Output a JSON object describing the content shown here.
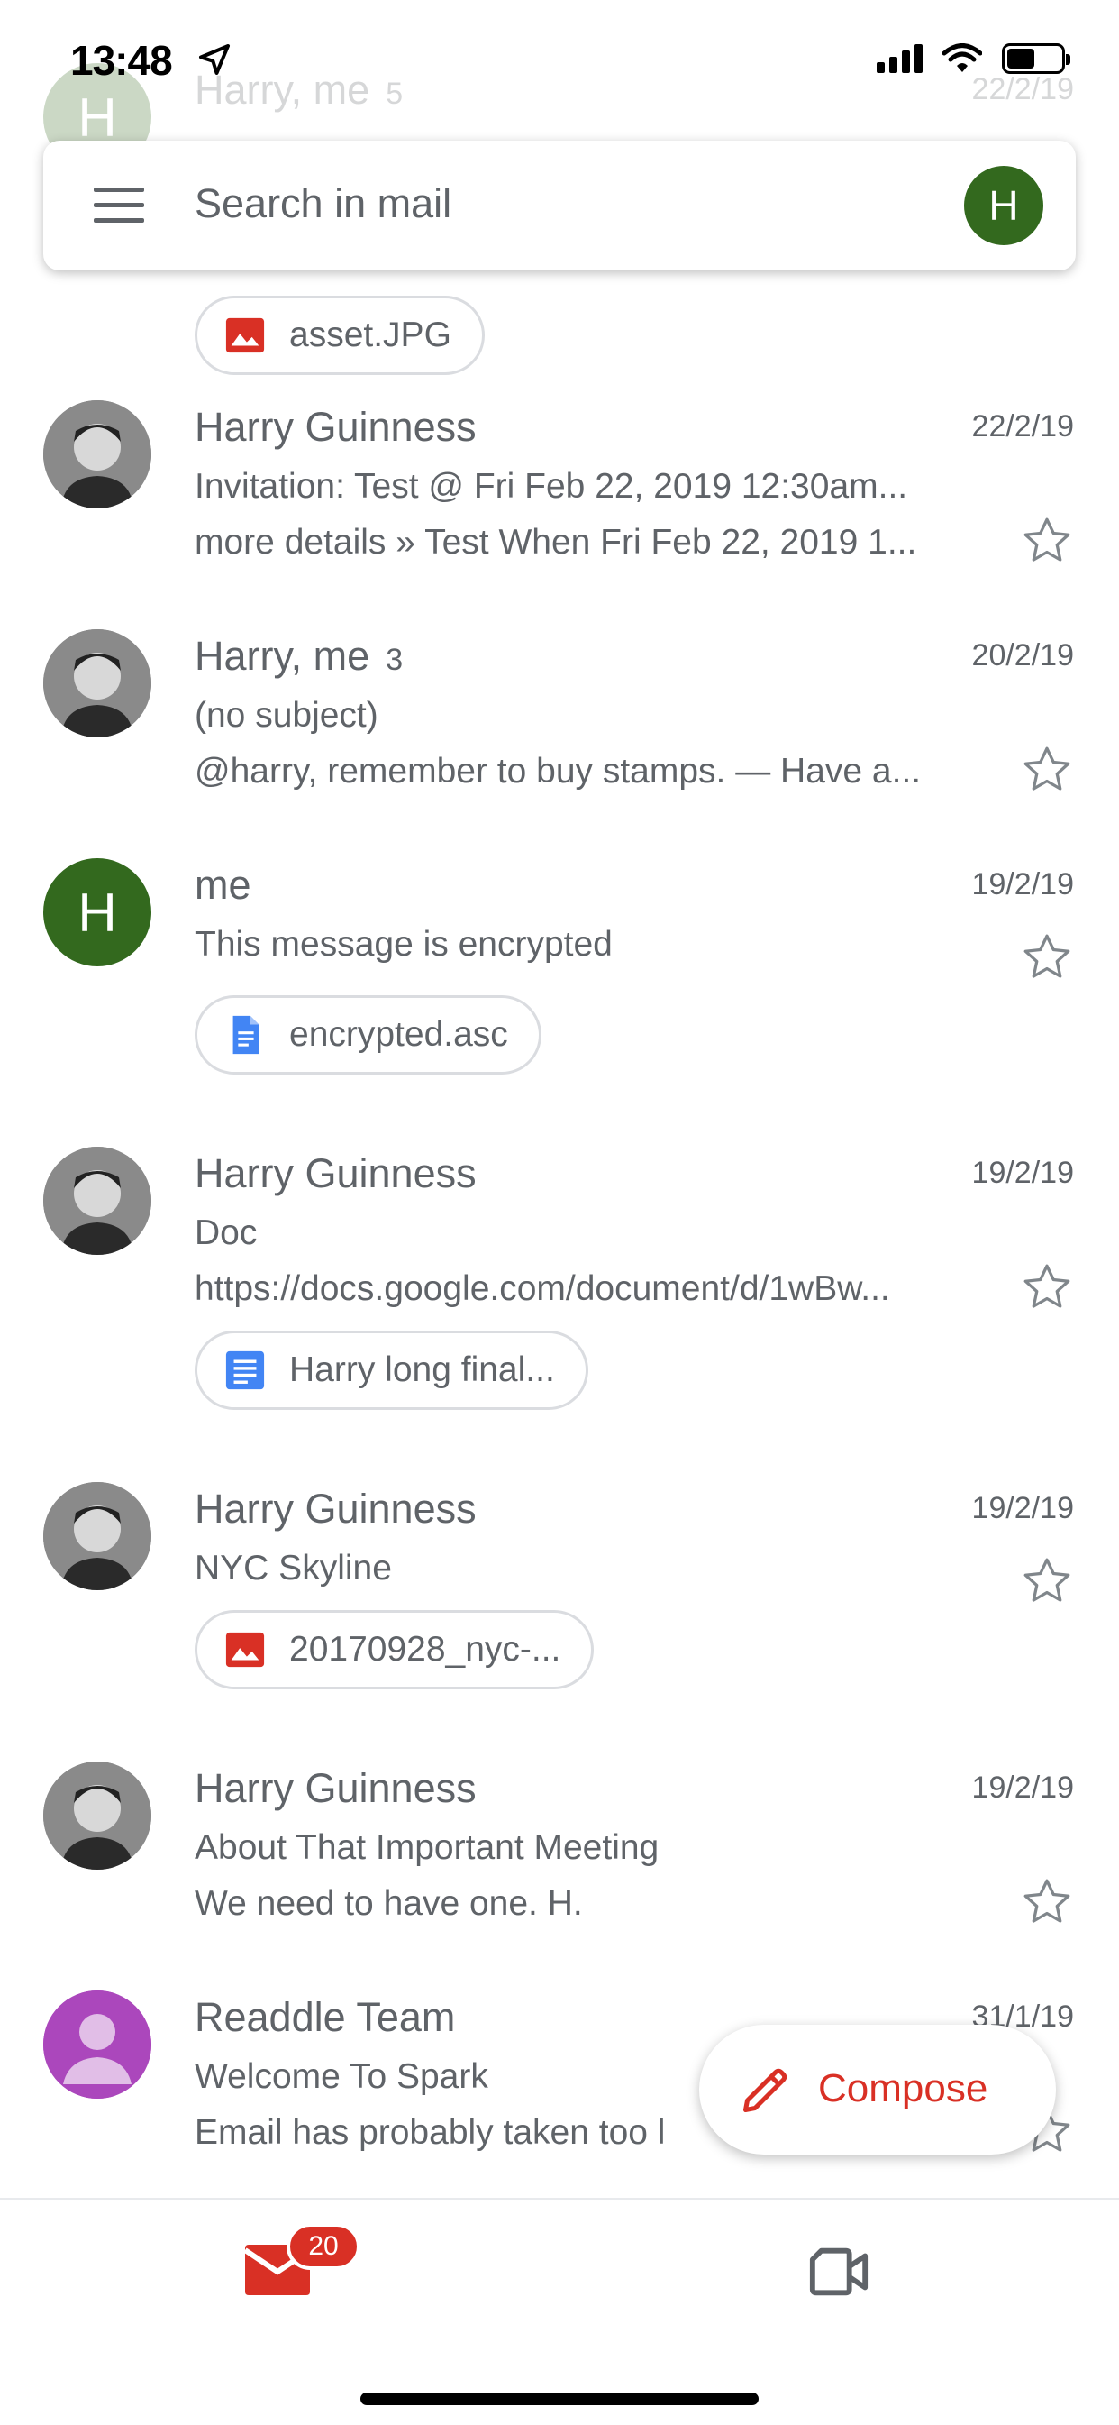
{
  "status_bar": {
    "time": "13:48"
  },
  "search": {
    "placeholder": "Search in mail",
    "avatar_initial": "H"
  },
  "partial_email": {
    "sender": "Harry, me",
    "count": "5",
    "date": "22/2/19",
    "attachment": "asset.JPG"
  },
  "emails": [
    {
      "sender": "Harry Guinness",
      "date": "22/2/19",
      "subject": "Invitation: Test @ Fri Feb 22, 2019 12:30am...",
      "preview": "more details » Test When Fri Feb 22, 2019 1..."
    },
    {
      "sender": "Harry, me",
      "count": "3",
      "date": "20/2/19",
      "subject": "(no subject)",
      "preview": "@harry, remember to buy stamps. — Have a..."
    },
    {
      "sender": "me",
      "avatar_initial": "H",
      "date": "19/2/19",
      "subject": "This message is encrypted",
      "attachment": "encrypted.asc"
    },
    {
      "sender": "Harry Guinness",
      "date": "19/2/19",
      "subject": "Doc",
      "preview": "https://docs.google.com/document/d/1wBw...",
      "attachment": "Harry long final..."
    },
    {
      "sender": "Harry Guinness",
      "date": "19/2/19",
      "subject": "NYC Skyline",
      "attachment": "20170928_nyc-..."
    },
    {
      "sender": "Harry Guinness",
      "date": "19/2/19",
      "subject": "About That Important Meeting",
      "preview": "We need to have one. H."
    },
    {
      "sender": "Readdle Team",
      "date": "31/1/19",
      "subject": "Welcome To Spark",
      "preview": "Email has probably taken too l"
    }
  ],
  "compose": {
    "label": "Compose"
  },
  "bottom_nav": {
    "mail_badge": "20"
  },
  "colors": {
    "accent_red": "#d93025",
    "avatar_green": "#33691e",
    "avatar_purple": "#ab47bc",
    "text_gray": "#5f6368"
  }
}
